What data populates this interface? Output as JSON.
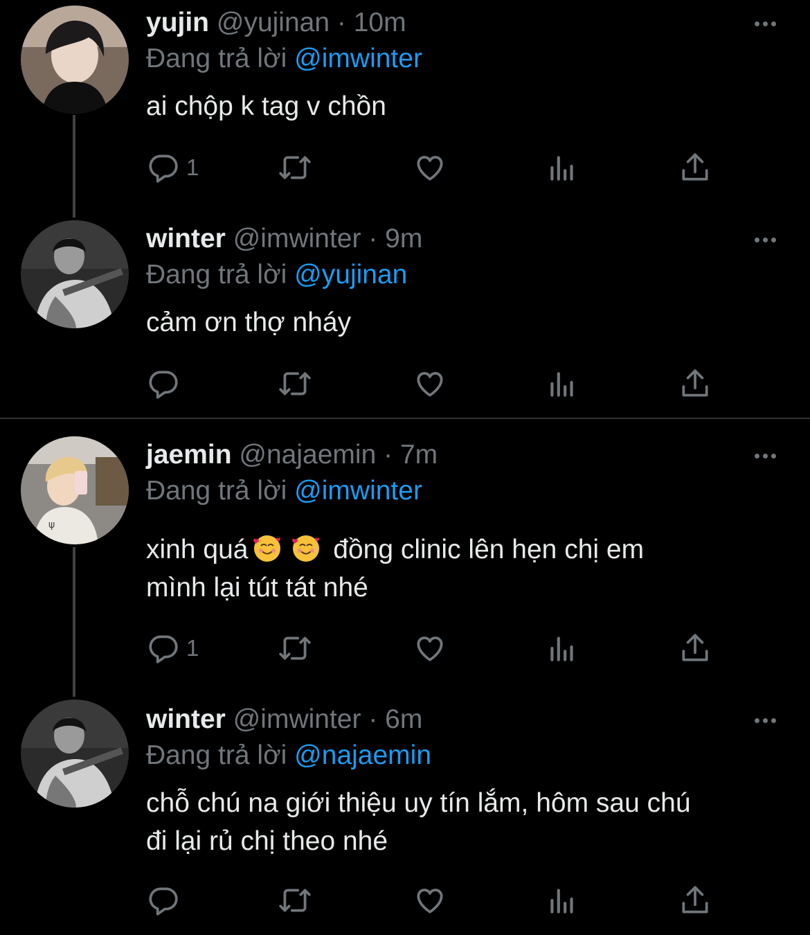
{
  "replying_to_label": "Đang trả lời",
  "tweets": [
    {
      "name": "yujin",
      "handle": "@yujinan",
      "separator": "·",
      "time": "10m",
      "reply_to": "@imwinter",
      "lines": [
        "ai chộp k tag v chồn"
      ],
      "reply_count": "1"
    },
    {
      "name": "winter",
      "handle": "@imwinter",
      "separator": "·",
      "time": "9m",
      "reply_to": "@yujinan",
      "lines": [
        "cảm ơn thợ nháy"
      ],
      "reply_count": ""
    },
    {
      "name": "jaemin",
      "handle": "@najaemin",
      "separator": "·",
      "time": "7m",
      "reply_to": "@imwinter",
      "line1_before_emoji": "xinh quá",
      "line1_after_emoji": " đồng clinic lên hẹn chị em",
      "line2": "mình lại tút tát nhé",
      "emojis": [
        "smiling-face-with-hearts",
        "smiling-face-with-hearts"
      ],
      "reply_count": "1"
    },
    {
      "name": "winter",
      "handle": "@imwinter",
      "separator": "·",
      "time": "6m",
      "reply_to": "@najaemin",
      "lines": [
        "chỗ chú na giới thiệu uy tín lắm, hôm sau chú",
        "đi lại rủ chị theo nhé"
      ],
      "reply_count": ""
    }
  ],
  "colors": {
    "background": "#000000",
    "text": "#e7e9ea",
    "muted": "#71767b",
    "mention": "#1d9bf0",
    "thread_line": "#3e4144"
  },
  "icons": [
    "reply-icon",
    "retweet-icon",
    "like-icon",
    "views-icon",
    "share-icon",
    "more-icon"
  ]
}
